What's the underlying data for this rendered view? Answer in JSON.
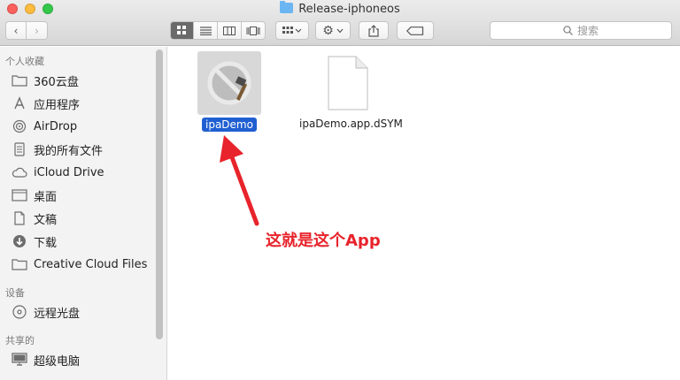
{
  "window": {
    "title": "Release-iphoneos"
  },
  "toolbar": {
    "back_glyph": "‹",
    "forward_glyph": "›",
    "view_modes": [
      "icon-view",
      "list-view",
      "column-view",
      "cover-flow-view"
    ],
    "search_placeholder": "搜索"
  },
  "sidebar": {
    "favorites_header": "个人收藏",
    "favorites": [
      {
        "label": "360云盘",
        "icon": "folder-icon"
      },
      {
        "label": "应用程序",
        "icon": "applications-icon"
      },
      {
        "label": "AirDrop",
        "icon": "airdrop-icon"
      },
      {
        "label": "我的所有文件",
        "icon": "all-files-icon"
      },
      {
        "label": "iCloud Drive",
        "icon": "cloud-icon"
      },
      {
        "label": "桌面",
        "icon": "desktop-icon"
      },
      {
        "label": "文稿",
        "icon": "documents-icon"
      },
      {
        "label": "下载",
        "icon": "download-icon"
      },
      {
        "label": "Creative Cloud Files",
        "icon": "folder-icon"
      }
    ],
    "devices_header": "设备",
    "devices": [
      {
        "label": "远程光盘",
        "icon": "disc-icon"
      }
    ],
    "shared_header": "共享的",
    "shared": [
      {
        "label": "超级电脑",
        "icon": "computer-icon"
      }
    ]
  },
  "files": [
    {
      "name": "ipaDemo",
      "selected": true,
      "icon": "app-icon"
    },
    {
      "name": "ipaDemo.app.dSYM",
      "selected": false,
      "icon": "document-icon"
    }
  ],
  "annotation": {
    "text": "这就是这个App",
    "color": "#e8232b"
  }
}
